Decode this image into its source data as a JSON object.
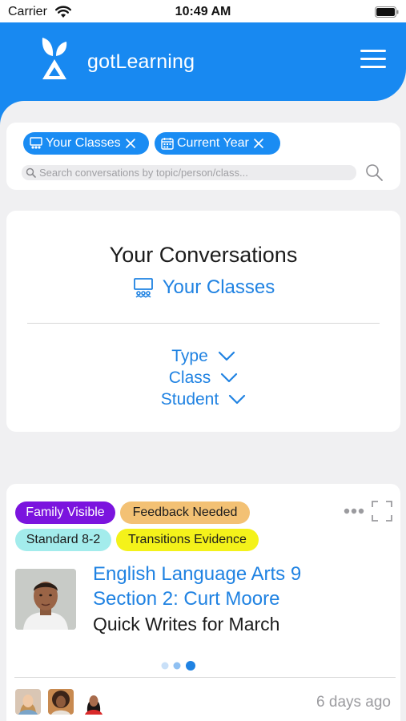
{
  "status_bar": {
    "carrier": "Carrier",
    "time": "10:49 AM"
  },
  "app": {
    "name": "gotLearning"
  },
  "colors": {
    "brand": "#1889f1",
    "link": "#1f82e2",
    "family_visible": "#7b14de",
    "feedback_needed": "#f3c174",
    "standard": "#a3ecec",
    "transitions": "#f4f21a"
  },
  "filters": {
    "chips": [
      {
        "label": "Your Classes",
        "icon": "classroom-icon"
      },
      {
        "label": "Current Year",
        "icon": "calendar-icon"
      }
    ],
    "search_placeholder": "Search conversations by topic/person/class..."
  },
  "conversations": {
    "title": "Your Conversations",
    "subtitle": "Your Classes",
    "filters": [
      "Type",
      "Class",
      "Student"
    ]
  },
  "post": {
    "tags": [
      "Family Visible",
      "Feedback Needed",
      "Standard 8-2",
      "Transitions Evidence"
    ],
    "class_line1": "English Language Arts 9",
    "class_line2": "Section 2: Curt Moore",
    "title": "Quick Writes for March",
    "time": "6 days ago",
    "carousel_total": 3,
    "carousel_active": 3
  }
}
